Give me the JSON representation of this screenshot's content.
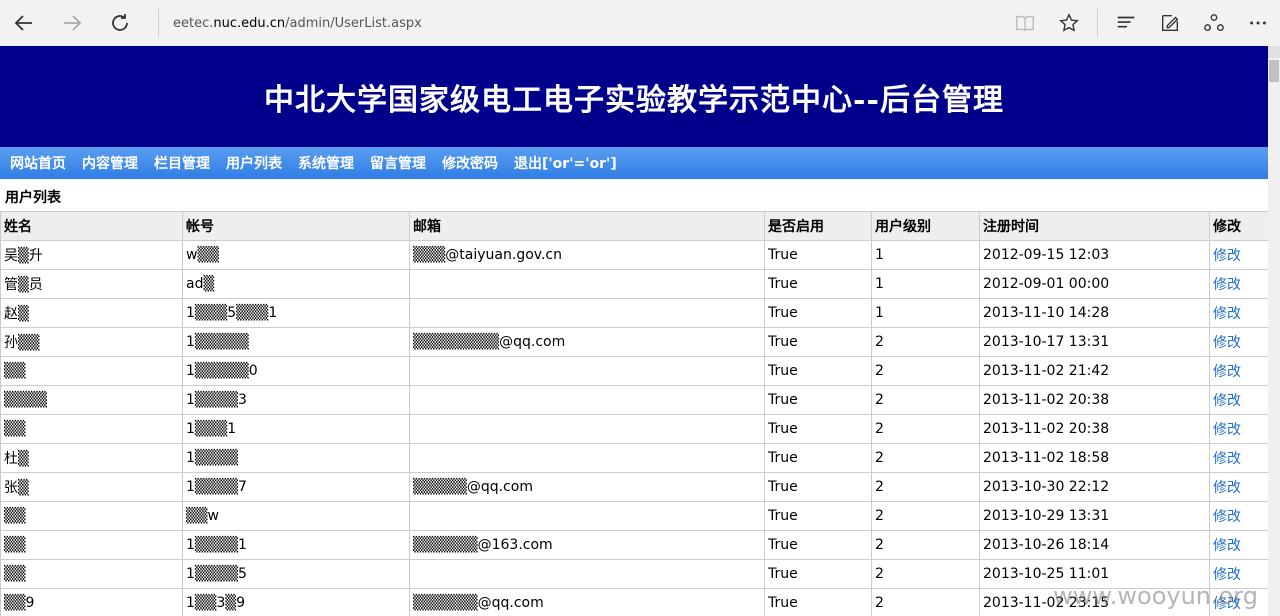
{
  "browser": {
    "url_prefix": "eetec.",
    "url_host": "nuc.edu.cn",
    "url_path": "/admin/UserList.aspx"
  },
  "banner": {
    "title": "中北大学国家级电工电子实验教学示范中心--后台管理"
  },
  "menu": [
    "网站首页",
    "内容管理",
    "栏目管理",
    "用户列表",
    "系统管理",
    "留言管理",
    "修改密码",
    "退出['or'='or']"
  ],
  "section_title": "用户列表",
  "table": {
    "headers": [
      "姓名",
      "帐号",
      "邮箱",
      "是否启用",
      "用户级别",
      "注册时间",
      "修改"
    ],
    "rows": [
      {
        "name": "吴▒升",
        "account": "w▒▒",
        "email": "▒▒▒@taiyuan.gov.cn",
        "enabled": "True",
        "level": "1",
        "time": "2012-09-15 12:03",
        "edit": "修改"
      },
      {
        "name": "管▒员",
        "account": "ad▒",
        "email": "",
        "enabled": "True",
        "level": "1",
        "time": "2012-09-01 00:00",
        "edit": "修改"
      },
      {
        "name": "赵▒",
        "account": "1▒▒▒5▒▒▒1",
        "email": "",
        "enabled": "True",
        "level": "1",
        "time": "2013-11-10 14:28",
        "edit": "修改"
      },
      {
        "name": "孙▒▒",
        "account": "1▒▒▒▒▒",
        "email": "▒▒▒▒▒▒▒▒@qq.com",
        "enabled": "True",
        "level": "2",
        "time": "2013-10-17 13:31",
        "edit": "修改"
      },
      {
        "name": "▒▒",
        "account": "1▒▒▒▒▒0",
        "email": "",
        "enabled": "True",
        "level": "2",
        "time": "2013-11-02 21:42",
        "edit": "修改"
      },
      {
        "name": "▒▒▒▒",
        "account": "1▒▒▒▒3",
        "email": "",
        "enabled": "True",
        "level": "2",
        "time": "2013-11-02 20:38",
        "edit": "修改"
      },
      {
        "name": "▒▒",
        "account": "1▒▒▒1",
        "email": "",
        "enabled": "True",
        "level": "2",
        "time": "2013-11-02 20:38",
        "edit": "修改"
      },
      {
        "name": "杜▒",
        "account": "1▒▒▒▒",
        "email": "",
        "enabled": "True",
        "level": "2",
        "time": "2013-11-02 18:58",
        "edit": "修改"
      },
      {
        "name": "张▒",
        "account": "1▒▒▒▒7",
        "email": "▒▒▒▒▒@qq.com",
        "enabled": "True",
        "level": "2",
        "time": "2013-10-30 22:12",
        "edit": "修改"
      },
      {
        "name": "▒▒",
        "account": "▒▒w",
        "email": "",
        "enabled": "True",
        "level": "2",
        "time": "2013-10-29 13:31",
        "edit": "修改"
      },
      {
        "name": "▒▒",
        "account": "1▒▒▒▒1",
        "email": "▒▒▒▒▒▒@163.com",
        "enabled": "True",
        "level": "2",
        "time": "2013-10-26 18:14",
        "edit": "修改"
      },
      {
        "name": "▒▒",
        "account": "1▒▒▒▒5",
        "email": "",
        "enabled": "True",
        "level": "2",
        "time": "2013-10-25 11:01",
        "edit": "修改"
      },
      {
        "name": "▒▒9",
        "account": "1▒▒3▒9",
        "email": "▒▒▒▒▒▒@qq.com",
        "enabled": "True",
        "level": "2",
        "time": "2013-11-02 23:15",
        "edit": "修改"
      }
    ]
  },
  "watermark": "www.wooyun.org"
}
